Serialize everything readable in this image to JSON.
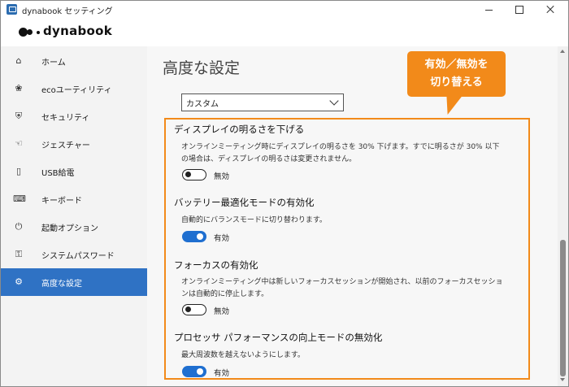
{
  "window": {
    "title": "dynabook セッティング",
    "minimize": "minimize",
    "maximize": "maximize",
    "close": "close"
  },
  "brand": {
    "name": "dynabook"
  },
  "sidebar": {
    "items": [
      {
        "label": "ホーム",
        "icon": "home-icon",
        "glyph": "⌂",
        "active": false
      },
      {
        "label": "ecoユーティリティ",
        "icon": "eco-icon",
        "glyph": "❀",
        "active": false
      },
      {
        "label": "セキュリティ",
        "icon": "shield-icon",
        "glyph": "⛨",
        "active": false
      },
      {
        "label": "ジェスチャー",
        "icon": "gesture-icon",
        "glyph": "☜",
        "active": false
      },
      {
        "label": "USB給電",
        "icon": "usb-icon",
        "glyph": "▯",
        "active": false
      },
      {
        "label": "キーボード",
        "icon": "keyboard-icon",
        "glyph": "⌨",
        "active": false
      },
      {
        "label": "起動オプション",
        "icon": "power-icon",
        "glyph": "⏻",
        "active": false
      },
      {
        "label": "システムパスワード",
        "icon": "key-icon",
        "glyph": "⚿",
        "active": false
      },
      {
        "label": "高度な設定",
        "icon": "gear-icon",
        "glyph": "⚙",
        "active": true
      }
    ]
  },
  "main": {
    "title": "高度な設定",
    "profile_select": {
      "value": "カスタム"
    },
    "sections": [
      {
        "title": "ディスプレイの明るさを下げる",
        "description": "オンラインミーティング時にディスプレイの明るさを 30% 下げます。すでに明るさが 30% 以下の場合は、ディスプレイの明るさは変更されません。",
        "state": "無効",
        "on": false
      },
      {
        "title": "バッテリー最適化モードの有効化",
        "description": "自動的にバランスモードに切り替わります。",
        "state": "有効",
        "on": true
      },
      {
        "title": "フォーカスの有効化",
        "description": "オンラインミーティング中は新しいフォーカスセッションが開始され、以前のフォーカスセッションは自動的に停止します。",
        "state": "無効",
        "on": false
      },
      {
        "title": "プロセッサ パフォーマンスの向上モードの無効化",
        "description": "最大周波数を越えないようにします。",
        "state": "有効",
        "on": true
      }
    ]
  },
  "callout": {
    "line1": "有効／無効を",
    "line2": "切り替える",
    "color": "#f28a1a"
  },
  "colors": {
    "accent": "#2f72c4",
    "toggle_on": "#1f6fd0",
    "highlight": "#f28a1a"
  }
}
